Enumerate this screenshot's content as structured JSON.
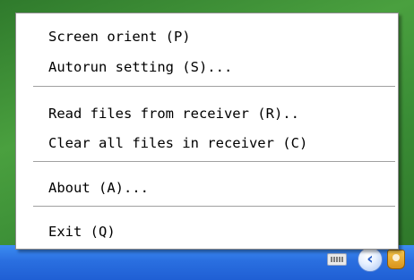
{
  "menu": {
    "items": [
      {
        "id": "screen-orient",
        "label": "Screen orient (P)"
      },
      {
        "id": "autorun-setting",
        "label": "Autorun setting (S)..."
      },
      {
        "id": "read-files",
        "label": "Read files from receiver (R).."
      },
      {
        "id": "clear-files",
        "label": "Clear all files in receiver (C)"
      },
      {
        "id": "about",
        "label": "About (A)..."
      },
      {
        "id": "exit",
        "label": "Exit (Q)"
      }
    ]
  },
  "taskbar": {
    "tray_icons": [
      "keyboard-icon",
      "chevron-left-icon",
      "app-tray-icon"
    ],
    "chevron_glyph": "‹"
  },
  "colors": {
    "menu_background": "#ffffff",
    "separator": "#a0a0a0",
    "taskbar": "#2a6fe0",
    "desktop": "#3f8f3a"
  }
}
